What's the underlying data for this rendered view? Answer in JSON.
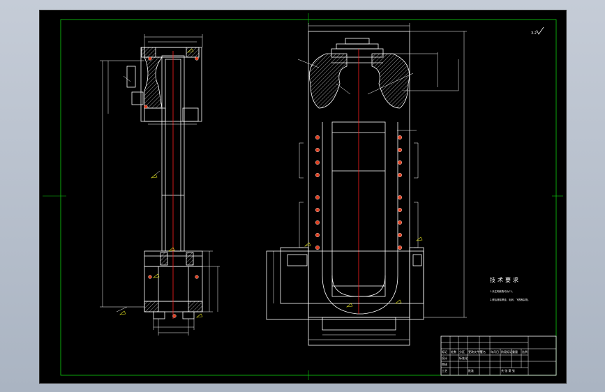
{
  "colors": {
    "background": "#000000",
    "frame": "#10d010",
    "outline": "#ffffff",
    "centerline": "#ff2020",
    "bolt": "#e04020",
    "desktop": "#b9c2cf"
  },
  "technical_requirements": {
    "title": "技术要求",
    "notes": [
      "1.未注明倒角均为C1。",
      "2.焊后清除焊渣、毛刺、飞溅等杂物。"
    ]
  },
  "roughness_mark": {
    "value": "3.2"
  },
  "title_block": {
    "cells": [
      "标记",
      "处数",
      "分区",
      "更改文件号",
      "签名",
      "年月日",
      "设计",
      "标准化",
      "审核",
      "工艺",
      "批准",
      "阶段标记",
      "重量",
      "比例",
      "共 张 第 张"
    ]
  }
}
